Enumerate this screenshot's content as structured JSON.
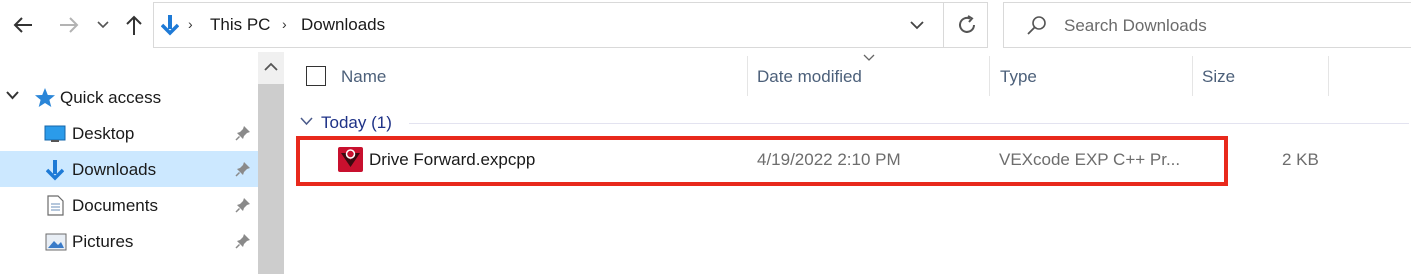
{
  "toolbar": {
    "back_icon": "arrow-left-icon",
    "forward_icon": "arrow-right-icon",
    "recent_icon": "chevron-down-icon",
    "up_icon": "arrow-up-icon"
  },
  "address": {
    "location_icon": "download-arrow-icon",
    "breadcrumbs": [
      "This PC",
      "Downloads"
    ],
    "dropdown_icon": "chevron-down-icon",
    "refresh_icon": "refresh-icon"
  },
  "search": {
    "placeholder": "Search Downloads",
    "icon": "search-icon"
  },
  "nav_pane": {
    "quick_access": {
      "label": "Quick access",
      "icon": "star-icon"
    },
    "items": [
      {
        "label": "Desktop",
        "icon": "desktop-icon",
        "pinned": true,
        "selected": false
      },
      {
        "label": "Downloads",
        "icon": "download-arrow-icon",
        "pinned": true,
        "selected": true
      },
      {
        "label": "Documents",
        "icon": "document-icon",
        "pinned": true,
        "selected": false
      },
      {
        "label": "Pictures",
        "icon": "pictures-icon",
        "pinned": true,
        "selected": false
      }
    ]
  },
  "file_list": {
    "columns": [
      "Name",
      "Date modified",
      "Type",
      "Size"
    ],
    "group": {
      "label": "Today (1)"
    },
    "files": [
      {
        "name": "Drive Forward.expcpp",
        "date_modified": "4/19/2022 2:10 PM",
        "type": "VEXcode EXP C++ Pr...",
        "size": "2 KB",
        "icon": "vexcode-file-icon"
      }
    ]
  },
  "colors": {
    "selected_bg": "#cce8ff",
    "highlight_border": "#e8291c",
    "group_label": "#1e3287",
    "header_text": "#4c607a",
    "accent_blue": "#1e7ad6"
  }
}
